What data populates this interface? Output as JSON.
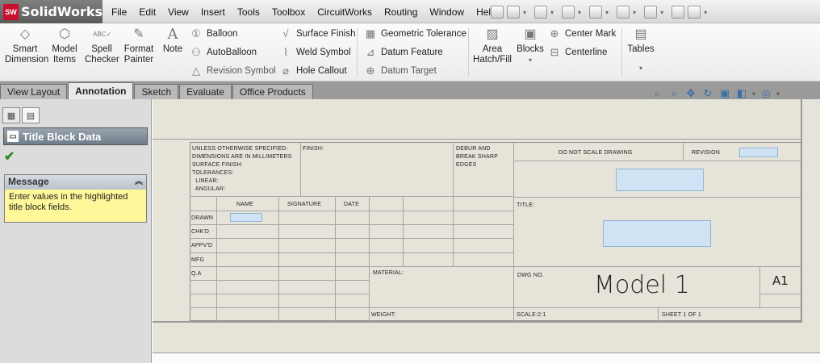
{
  "app": {
    "logo_mark": "SW",
    "name": "SolidWorks"
  },
  "menu": [
    "File",
    "Edit",
    "View",
    "Insert",
    "Tools",
    "Toolbox",
    "CircuitWorks",
    "Routing",
    "Window",
    "Help"
  ],
  "ribbon": {
    "smart_dimension": "Smart\nDimension",
    "model_items": "Model\nItems",
    "spell_checker": "Spell\nChecker",
    "format_painter": "Format\nPainter",
    "note": "Note",
    "balloon": "Balloon",
    "autoballoon": "AutoBalloon",
    "revision_symbol": "Revision Symbol",
    "surface_finish": "Surface Finish",
    "weld_symbol": "Weld Symbol",
    "hole_callout": "Hole Callout",
    "geometric_tolerance": "Geometric Tolerance",
    "datum_feature": "Datum Feature",
    "datum_target": "Datum Target",
    "area_hatch": "Area\nHatch/Fill",
    "blocks": "Blocks",
    "center_mark": "Center Mark",
    "centerline": "Centerline",
    "tables": "Tables"
  },
  "tabs": [
    "View Layout",
    "Annotation",
    "Sketch",
    "Evaluate",
    "Office Products"
  ],
  "active_tab": "Annotation",
  "property_manager": {
    "title": "Title Block Data",
    "message_title": "Message",
    "message_text": "Enter values in the highlighted title block fields."
  },
  "title_block": {
    "unless_lines": [
      "UNLESS OTHERWISE SPECIFIED:",
      "DIMENSIONS ARE IN MILLIMETERS",
      "SURFACE FINISH:",
      "TOLERANCES:",
      "  LINEAR:",
      "  ANGULAR:"
    ],
    "finish": "FINISH:",
    "deburr": [
      "DEBUR AND",
      "BREAK SHARP",
      "EDGES"
    ],
    "do_not_scale": "DO NOT SCALE DRAWING",
    "revision": "REVISION",
    "col_name": "NAME",
    "col_signature": "SIGNATURE",
    "col_date": "DATE",
    "rows": [
      "DRAWN",
      "CHK'D",
      "APPV'D",
      "MFG",
      "Q.A"
    ],
    "title_label": "TITLE:",
    "material": "MATERIAL:",
    "dwg_no": "DWG NO.",
    "model_name": "Model 1",
    "size": "A1",
    "weight": "WEIGHT:",
    "scale": "SCALE:2:1",
    "sheet": "SHEET 1 OF 1"
  },
  "colors": {
    "field_fill": "#cfe3f5",
    "message_bg": "#fff89a",
    "canvas_bg": "#e6e4d9",
    "check_green": "#2d8a2d"
  }
}
